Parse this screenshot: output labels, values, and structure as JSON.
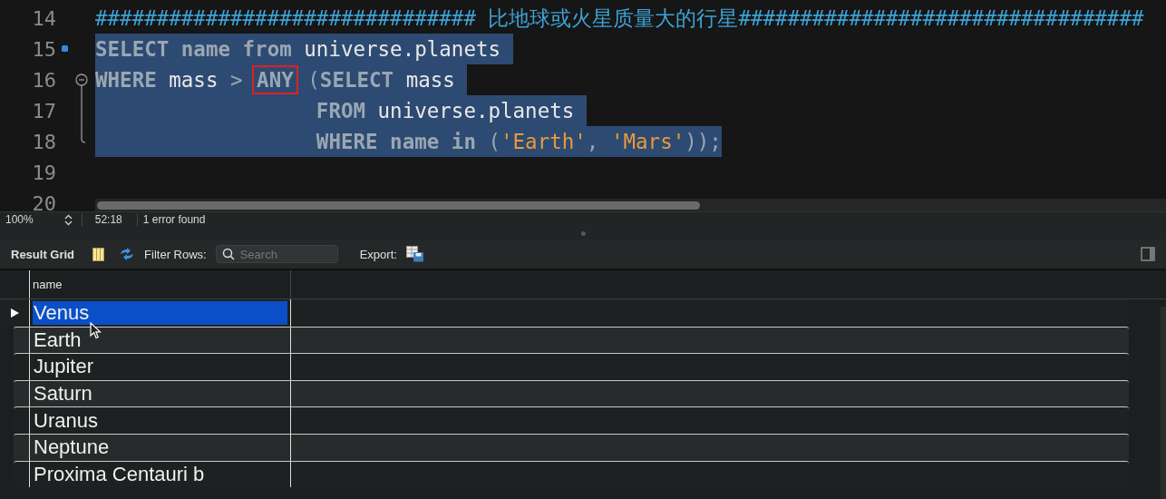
{
  "editor": {
    "lines": [
      {
        "number": "14",
        "marker": false,
        "kind": "plain",
        "selected": false,
        "tokens": [
          {
            "kind": "comment",
            "text": "############################### 比地球或火星质量大的行星#################################"
          }
        ]
      },
      {
        "number": "15",
        "marker": true,
        "kind": "plain",
        "selected": true,
        "tokens": [
          {
            "kind": "keyword",
            "text": "SELECT name from "
          },
          {
            "kind": "ident",
            "text": "universe.planets "
          }
        ]
      },
      {
        "number": "16",
        "marker": false,
        "kind": "fold-start",
        "selected": true,
        "tokens": [
          {
            "kind": "keyword",
            "text": "WHERE "
          },
          {
            "kind": "ident",
            "text": "mass "
          },
          {
            "kind": "punct",
            "text": "> "
          },
          {
            "kind": "keyword",
            "text": "ANY",
            "boxed": true
          },
          {
            "kind": "punct",
            "text": " ("
          },
          {
            "kind": "keyword",
            "text": "SELECT "
          },
          {
            "kind": "ident",
            "text": "mass "
          }
        ]
      },
      {
        "number": "17",
        "marker": false,
        "kind": "fold-body",
        "selected": true,
        "tokens": [
          {
            "kind": "keyword",
            "text": "                  FROM "
          },
          {
            "kind": "ident",
            "text": "universe.planets "
          }
        ]
      },
      {
        "number": "18",
        "marker": false,
        "kind": "fold-end",
        "selected": true,
        "tokens": [
          {
            "kind": "keyword",
            "text": "                  WHERE name in "
          },
          {
            "kind": "punct",
            "text": "("
          },
          {
            "kind": "string",
            "text": "'Earth'"
          },
          {
            "kind": "punct",
            "text": ", "
          },
          {
            "kind": "string",
            "text": "'Mars'"
          },
          {
            "kind": "punct",
            "text": "));"
          }
        ]
      },
      {
        "number": "19",
        "marker": false,
        "kind": "plain",
        "selected": false
      },
      {
        "number": "20",
        "marker": false,
        "kind": "plain",
        "selected": false
      }
    ]
  },
  "status_bar": {
    "zoom": "100%",
    "position": "52:18",
    "message": "1 error found"
  },
  "result_toolbar": {
    "title": "Result Grid",
    "filter_label": "Filter Rows:",
    "search": {
      "placeholder": "Search"
    },
    "export_label": "Export:"
  },
  "grid": {
    "columns": [
      "name"
    ],
    "rows": [
      {
        "name": "Venus",
        "selected": true
      },
      {
        "name": "Earth",
        "selected": false
      },
      {
        "name": "Jupiter",
        "selected": false
      },
      {
        "name": "Saturn",
        "selected": false
      },
      {
        "name": "Uranus",
        "selected": false
      },
      {
        "name": "Neptune",
        "selected": false
      },
      {
        "name": "Proxima Centauri b",
        "selected": false
      }
    ]
  }
}
